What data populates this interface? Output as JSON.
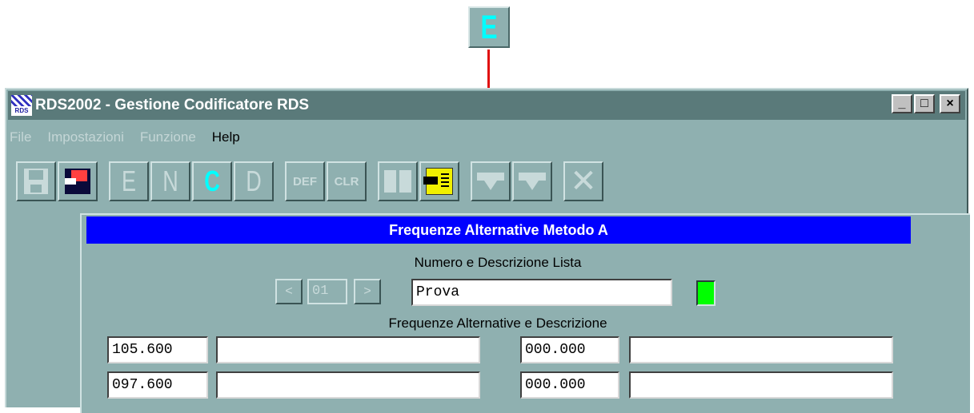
{
  "callout": {
    "letter": "E",
    "letter_color": "#00ffff",
    "arrow_color": "#e01010"
  },
  "window": {
    "title": "RDS2002 - Gestione Codificatore RDS",
    "icon_text": "RDS",
    "controls": {
      "minimize": "_",
      "maximize": "□",
      "close": "×"
    }
  },
  "menu": [
    {
      "label": "File",
      "enabled": false
    },
    {
      "label": "Impostazioni",
      "enabled": false
    },
    {
      "label": "Funzione",
      "enabled": false
    },
    {
      "label": "Help",
      "enabled": true
    }
  ],
  "toolbar": {
    "save_icon": "floppy-disk-icon",
    "load_icon": "floppy-load-icon",
    "letters": [
      "E",
      "N",
      "C",
      "D"
    ],
    "active_letter": "C",
    "def_label": "DEF",
    "clr_label": "CLR",
    "close_glyph": "✕"
  },
  "panel": {
    "header": "Frequenze Alternative Metodo A",
    "list_label": "Numero e Descrizione Lista",
    "prev": "<",
    "next": ">",
    "list_number": "01",
    "list_name": "Prova",
    "indicator_color": "#00ff00",
    "freq_label": "Frequenze Alternative e Descrizione",
    "rows": [
      {
        "left_freq": "105.600",
        "left_desc": "",
        "right_freq": "000.000",
        "right_desc": ""
      },
      {
        "left_freq": "097.600",
        "left_desc": "",
        "right_freq": "000.000",
        "right_desc": ""
      }
    ]
  }
}
